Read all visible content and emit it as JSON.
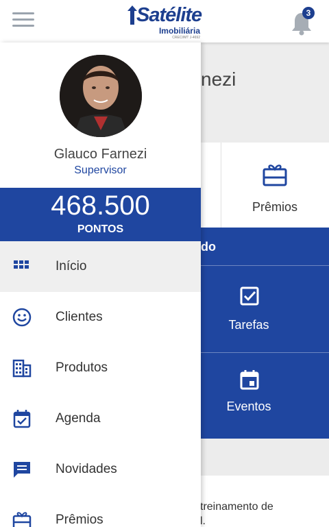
{
  "app": {
    "logo_text": "Satélite",
    "logo_sub": "Imobiliária",
    "logo_tiny": "CRECI/MT J-4692",
    "notifications_count": "3"
  },
  "background": {
    "name_partial": "nezi",
    "premios_label": "Prêmios",
    "section_partial": "do",
    "tarefas_label": "Tarefas",
    "eventos_label": "Eventos",
    "snippet_line1": "treinamento de",
    "snippet_line2": "l."
  },
  "drawer": {
    "user_name": "Glauco Farnezi",
    "user_role": "Supervisor",
    "points_value": "468.500",
    "points_label": "PONTOS",
    "items": [
      {
        "label": "Início",
        "icon": "grid-icon"
      },
      {
        "label": "Clientes",
        "icon": "smiley-icon"
      },
      {
        "label": "Produtos",
        "icon": "building-icon"
      },
      {
        "label": "Agenda",
        "icon": "calendar-check-icon"
      },
      {
        "label": "Novidades",
        "icon": "message-icon"
      },
      {
        "label": "Prêmios",
        "icon": "gift-icon"
      }
    ]
  },
  "colors": {
    "primary": "#1f46a0",
    "brand_dark": "#1d3f8f",
    "active_item_bg": "#efefef"
  }
}
